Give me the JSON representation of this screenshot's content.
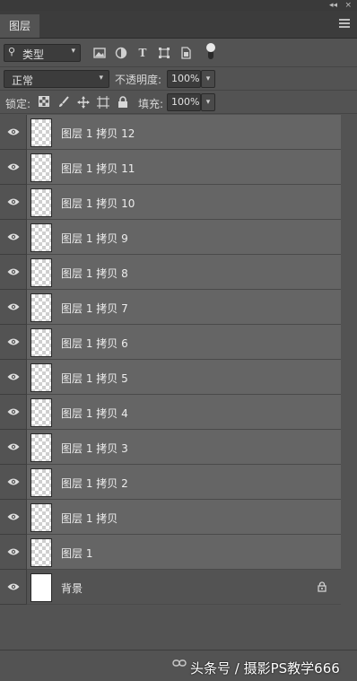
{
  "window": {
    "collapse_glyph": "◂◂",
    "close_glyph": "×"
  },
  "panel": {
    "tab_label": "图层"
  },
  "filter": {
    "kind_label": "类型",
    "search_glyph": "⚲",
    "arrow": "▾"
  },
  "blend": {
    "mode": "正常",
    "arrow": "▾"
  },
  "opacity": {
    "label": "不透明度:",
    "value": "100%"
  },
  "lock": {
    "label": "锁定:"
  },
  "fill": {
    "label": "填充:",
    "value": "100%"
  },
  "layers": [
    {
      "name": "图层 1 拷贝 12",
      "visible": true,
      "thumb": "transparent"
    },
    {
      "name": "图层 1 拷贝 11",
      "visible": true,
      "thumb": "transparent"
    },
    {
      "name": "图层 1 拷贝 10",
      "visible": true,
      "thumb": "transparent"
    },
    {
      "name": "图层 1 拷贝 9",
      "visible": true,
      "thumb": "transparent"
    },
    {
      "name": "图层 1 拷贝 8",
      "visible": true,
      "thumb": "transparent"
    },
    {
      "name": "图层 1 拷贝 7",
      "visible": true,
      "thumb": "transparent"
    },
    {
      "name": "图层 1 拷贝 6",
      "visible": true,
      "thumb": "transparent"
    },
    {
      "name": "图层 1 拷贝 5",
      "visible": true,
      "thumb": "transparent"
    },
    {
      "name": "图层 1 拷贝 4",
      "visible": true,
      "thumb": "transparent"
    },
    {
      "name": "图层 1 拷贝 3",
      "visible": true,
      "thumb": "transparent"
    },
    {
      "name": "图层 1 拷贝 2",
      "visible": true,
      "thumb": "transparent"
    },
    {
      "name": "图层 1 拷贝",
      "visible": true,
      "thumb": "transparent"
    },
    {
      "name": "图层 1",
      "visible": true,
      "thumb": "transparent"
    },
    {
      "name": "背景",
      "visible": true,
      "thumb": "white",
      "locked": true
    }
  ],
  "watermark": "头条号 / 摄影PS教学666"
}
